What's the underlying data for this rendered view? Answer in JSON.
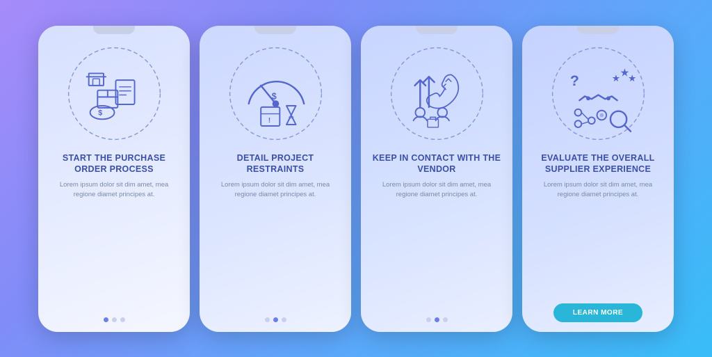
{
  "background": {
    "gradient_start": "#a78bfa",
    "gradient_end": "#38bdf8"
  },
  "phones": [
    {
      "id": "phone-1",
      "title": "START THE PURCHASE ORDER PROCESS",
      "description": "Lorem ipsum dolor sit dim amet, mea regione diamet principes at.",
      "dots": [
        true,
        false,
        false
      ],
      "has_learn_more": false,
      "illustration": "purchase-order"
    },
    {
      "id": "phone-2",
      "title": "DETAIL PROJECT RESTRAINTS",
      "description": "Lorem ipsum dolor sit dim amet, mea regione diamet principes at.",
      "dots": [
        false,
        true,
        false
      ],
      "has_learn_more": false,
      "illustration": "project-restraints"
    },
    {
      "id": "phone-3",
      "title": "KEEP IN CONTACT WITH THE VENDOR",
      "description": "Lorem ipsum dolor sit dim amet, mea regione diamet principes at.",
      "dots": [
        false,
        true,
        false
      ],
      "has_learn_more": false,
      "illustration": "vendor-contact"
    },
    {
      "id": "phone-4",
      "title": "EVALUATE THE OVERALL SUPPLIER EXPERIENCE",
      "description": "Lorem ipsum dolor sit dim amet, mea regione diamet principes at.",
      "dots": [
        false,
        false,
        false
      ],
      "has_learn_more": true,
      "learn_more_label": "LEARN MORE",
      "illustration": "supplier-experience"
    }
  ]
}
